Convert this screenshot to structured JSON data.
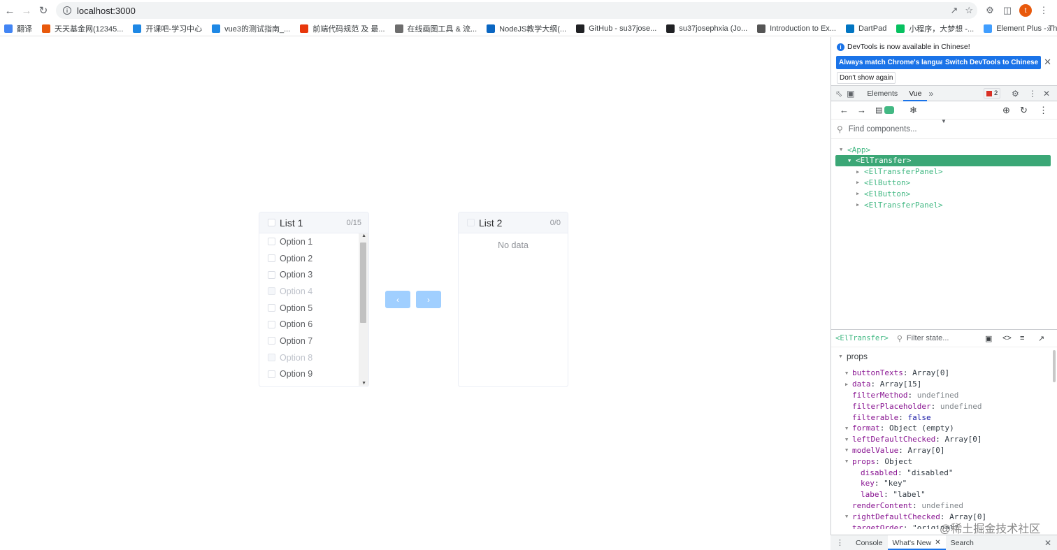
{
  "browser": {
    "url": "localhost:3000",
    "avatar_letter": "t",
    "bookmarks": [
      {
        "label": "翻译",
        "color": "#4285f4"
      },
      {
        "label": "天天基金网(12345...",
        "color": "#e8590c"
      },
      {
        "label": "开课吧-学习中心",
        "color": "#1e88e5"
      },
      {
        "label": "vue3的测试指南_...",
        "color": "#1e88e5"
      },
      {
        "label": "前端代码规范 及 最...",
        "color": "#e8370c"
      },
      {
        "label": "在线画图工具 & 流...",
        "color": "#6d6d6d"
      },
      {
        "label": "NodeJS教学大纲(...",
        "color": "#0a66c2"
      },
      {
        "label": "GitHub - su37jose...",
        "color": "#202124"
      },
      {
        "label": "su37josephxia (Jo...",
        "color": "#202124"
      },
      {
        "label": "Introduction to Ex...",
        "color": "#555555"
      },
      {
        "label": "DartPad",
        "color": "#0175c2"
      },
      {
        "label": "小程序，大梦想 -...",
        "color": "#07c160"
      },
      {
        "label": "Element Plus - Th...",
        "color": "#409eff"
      }
    ]
  },
  "transfer": {
    "left": {
      "title": "List 1",
      "count": "0/15",
      "options": [
        {
          "label": "Option 1",
          "disabled": false
        },
        {
          "label": "Option 2",
          "disabled": false
        },
        {
          "label": "Option 3",
          "disabled": false
        },
        {
          "label": "Option 4",
          "disabled": true
        },
        {
          "label": "Option 5",
          "disabled": false
        },
        {
          "label": "Option 6",
          "disabled": false
        },
        {
          "label": "Option 7",
          "disabled": false
        },
        {
          "label": "Option 8",
          "disabled": true
        },
        {
          "label": "Option 9",
          "disabled": false
        }
      ]
    },
    "right": {
      "title": "List 2",
      "count": "0/0",
      "empty_text": "No data"
    },
    "buttons": {
      "to_left": "‹",
      "to_right": "›"
    }
  },
  "devtools": {
    "notice": {
      "message": "DevTools is now available in Chinese!",
      "btn_match": "Always match Chrome's language",
      "btn_switch": "Switch DevTools to Chinese",
      "btn_dismiss": "Don't show again"
    },
    "tabs": [
      "Elements",
      "Vue"
    ],
    "active_tab": "Vue",
    "issues_count": "2",
    "find_placeholder": "Find components...",
    "tree": [
      {
        "label": "<App>",
        "depth": 0,
        "expanded": true,
        "selected": false
      },
      {
        "label": "<ElTransfer>",
        "depth": 1,
        "expanded": true,
        "selected": true
      },
      {
        "label": "<ElTransferPanel>",
        "depth": 2,
        "expanded": false,
        "selected": false
      },
      {
        "label": "<ElButton>",
        "depth": 2,
        "expanded": false,
        "selected": false
      },
      {
        "label": "<ElButton>",
        "depth": 2,
        "expanded": false,
        "selected": false
      },
      {
        "label": "<ElTransferPanel>",
        "depth": 2,
        "expanded": false,
        "selected": false
      }
    ],
    "selected_component": "<ElTransfer>",
    "filter_placeholder": "Filter state...",
    "section": "props",
    "props": [
      {
        "key": "buttonTexts",
        "value": "Array[0]",
        "tri": "down",
        "type": "obj",
        "depth": 0
      },
      {
        "key": "data",
        "value": "Array[15]",
        "tri": "right",
        "type": "obj",
        "depth": 0
      },
      {
        "key": "filterMethod",
        "value": "undefined",
        "tri": "",
        "type": "undef",
        "depth": 0
      },
      {
        "key": "filterPlaceholder",
        "value": "undefined",
        "tri": "",
        "type": "undef",
        "depth": 0
      },
      {
        "key": "filterable",
        "value": "false",
        "tri": "",
        "type": "bool",
        "depth": 0
      },
      {
        "key": "format",
        "value": "Object (empty)",
        "tri": "down",
        "type": "obj",
        "depth": 0
      },
      {
        "key": "leftDefaultChecked",
        "value": "Array[0]",
        "tri": "down",
        "type": "obj",
        "depth": 0
      },
      {
        "key": "modelValue",
        "value": "Array[0]",
        "tri": "down",
        "type": "obj",
        "depth": 0
      },
      {
        "key": "props",
        "value": "Object",
        "tri": "down",
        "type": "obj",
        "depth": 0
      },
      {
        "key": "disabled",
        "value": "\"disabled\"",
        "tri": "",
        "type": "str",
        "depth": 1
      },
      {
        "key": "key",
        "value": "\"key\"",
        "tri": "",
        "type": "str",
        "depth": 1
      },
      {
        "key": "label",
        "value": "\"label\"",
        "tri": "",
        "type": "str",
        "depth": 1
      },
      {
        "key": "renderContent",
        "value": "undefined",
        "tri": "",
        "type": "undef",
        "depth": 0
      },
      {
        "key": "rightDefaultChecked",
        "value": "Array[0]",
        "tri": "down",
        "type": "obj",
        "depth": 0
      },
      {
        "key": "targetOrder",
        "value": "\"original\"",
        "tri": "",
        "type": "str",
        "depth": 0
      }
    ],
    "drawer_tabs": [
      "Console",
      "What's New",
      "Search"
    ],
    "drawer_active": "What's New"
  },
  "watermark": "@稀土掘金技术社区",
  "colors": {
    "vue_green": "#42b883",
    "el_primary_light": "#a0cfff",
    "chrome_blue": "#1a73e8"
  }
}
